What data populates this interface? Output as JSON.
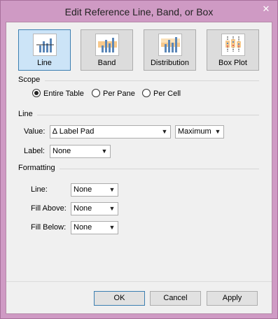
{
  "window": {
    "title": "Edit Reference Line, Band, or Box",
    "close_glyph": "✕"
  },
  "types": [
    {
      "label": "Line",
      "icon": "reference-line-icon",
      "selected": true
    },
    {
      "label": "Band",
      "icon": "reference-band-icon",
      "selected": false
    },
    {
      "label": "Distribution",
      "icon": "distribution-icon",
      "selected": false
    },
    {
      "label": "Box Plot",
      "icon": "box-plot-icon",
      "selected": false
    }
  ],
  "scope": {
    "heading": "Scope",
    "options": [
      {
        "label": "Entire Table",
        "checked": true
      },
      {
        "label": "Per Pane",
        "checked": false
      },
      {
        "label": "Per Cell",
        "checked": false
      }
    ]
  },
  "line": {
    "heading": "Line",
    "value_label": "Value:",
    "value_field": "∆ Label Pad",
    "aggregation": "Maximum",
    "label_label": "Label:",
    "label_value": "None"
  },
  "formatting": {
    "heading": "Formatting",
    "line_label": "Line:",
    "line_value": "None",
    "fill_above_label": "Fill Above:",
    "fill_above_value": "None",
    "fill_below_label": "Fill Below:",
    "fill_below_value": "None"
  },
  "buttons": {
    "ok": "OK",
    "cancel": "Cancel",
    "apply": "Apply"
  },
  "colors": {
    "accent": "#3c7fb1",
    "bar_blue": "#5b87b8",
    "band_orange": "#f7c98c",
    "frame": "#cf9ac4"
  }
}
